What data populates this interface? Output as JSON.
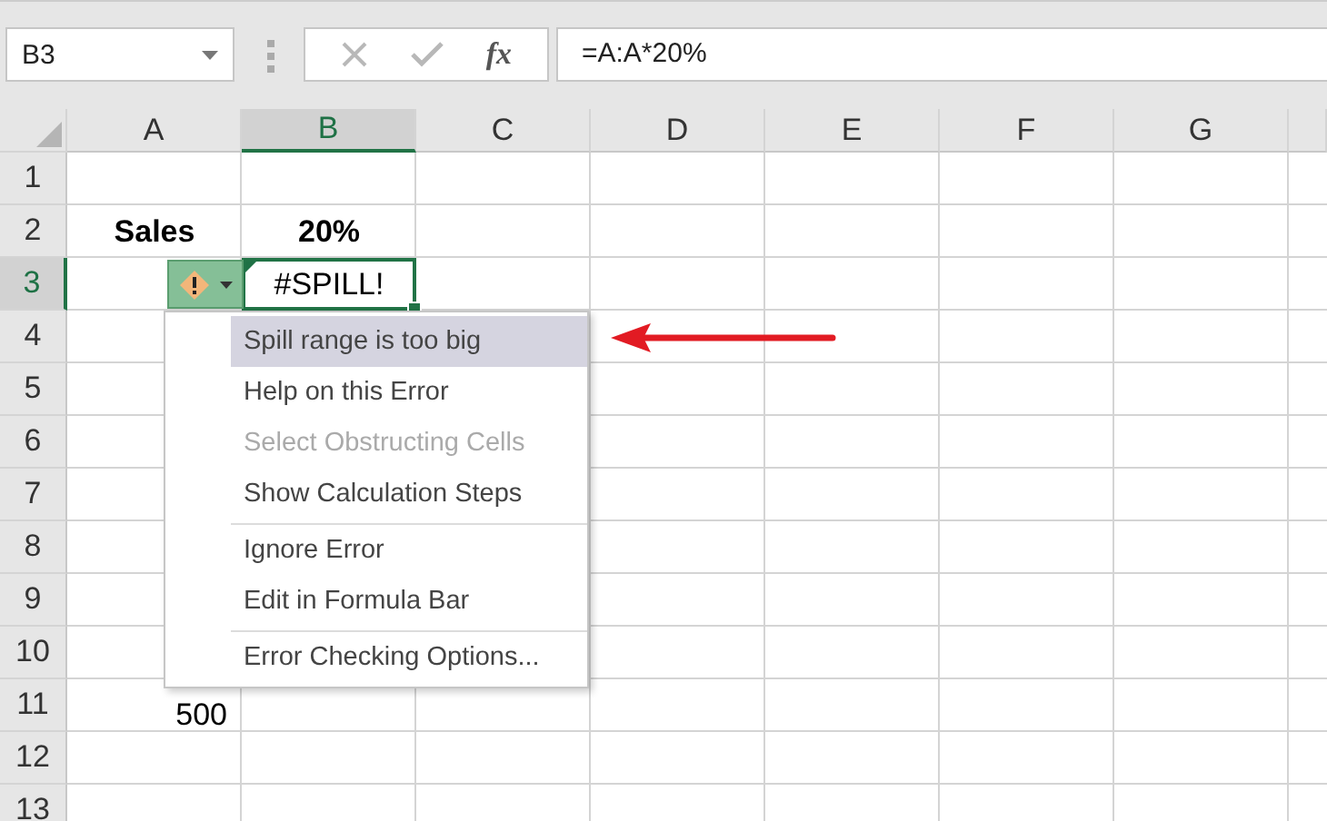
{
  "name_box": {
    "value": "B3"
  },
  "formula_bar": {
    "cancel_disabled": true,
    "enter_disabled": true,
    "function_label": "fx",
    "value": "=A:A*20%"
  },
  "columns": [
    {
      "label": "A",
      "selected": false
    },
    {
      "label": "B",
      "selected": true
    },
    {
      "label": "C",
      "selected": false
    },
    {
      "label": "D",
      "selected": false
    },
    {
      "label": "E",
      "selected": false
    },
    {
      "label": "F",
      "selected": false
    },
    {
      "label": "G",
      "selected": false
    }
  ],
  "rows": [
    {
      "label": "1",
      "selected": false
    },
    {
      "label": "2",
      "selected": false,
      "cells": [
        {
          "kind": "header",
          "text": "Sales",
          "selected": false
        },
        {
          "kind": "header",
          "text": "20%",
          "selected": false
        }
      ]
    },
    {
      "label": "3",
      "selected": true,
      "cells": [
        {
          "kind": "error_button",
          "selected": false
        },
        {
          "kind": "error",
          "text": "#SPILL!",
          "selected": true
        }
      ]
    },
    {
      "label": "4",
      "selected": false
    },
    {
      "label": "5",
      "selected": false
    },
    {
      "label": "6",
      "selected": false
    },
    {
      "label": "7",
      "selected": false
    },
    {
      "label": "8",
      "selected": false
    },
    {
      "label": "9",
      "selected": false
    },
    {
      "label": "10",
      "selected": false
    },
    {
      "label": "11",
      "selected": false,
      "cells": [
        {
          "kind": "number",
          "text": "500",
          "selected": false
        }
      ]
    },
    {
      "label": "12",
      "selected": false
    },
    {
      "label": "13",
      "selected": false
    }
  ],
  "menu": {
    "items": [
      {
        "label": "Spill range is too big",
        "highlighted": true,
        "disabled": false,
        "separator_before": false
      },
      {
        "label": "Help on this Error",
        "highlighted": false,
        "disabled": false,
        "separator_before": false
      },
      {
        "label": "Select Obstructing Cells",
        "highlighted": false,
        "disabled": true,
        "separator_before": false
      },
      {
        "label": "Show Calculation Steps",
        "highlighted": false,
        "disabled": false,
        "separator_before": false
      },
      {
        "label": "Ignore Error",
        "highlighted": false,
        "disabled": false,
        "separator_before": true
      },
      {
        "label": "Edit in Formula Bar",
        "highlighted": false,
        "disabled": false,
        "separator_before": false
      },
      {
        "label": "Error Checking Options...",
        "highlighted": false,
        "disabled": false,
        "separator_before": true
      }
    ]
  }
}
